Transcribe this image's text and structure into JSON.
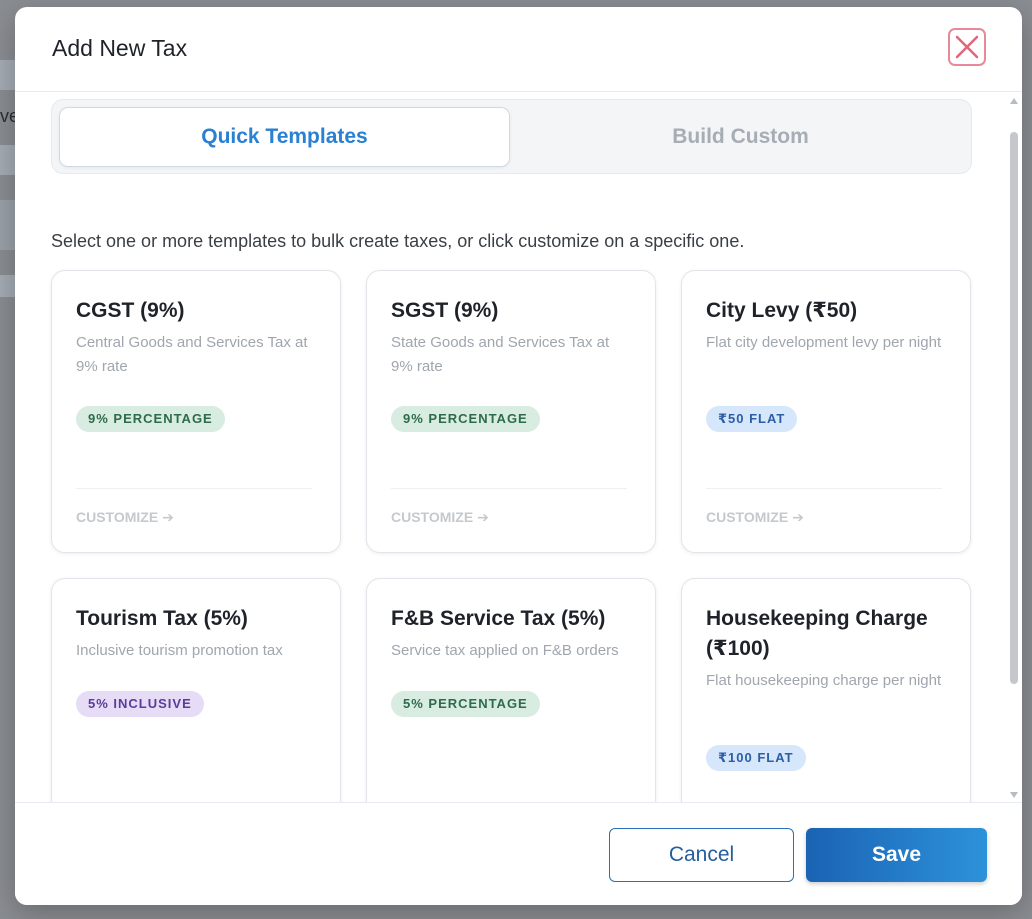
{
  "background": {
    "partial_text": "ve"
  },
  "modal": {
    "title": "Add New Tax",
    "close_icon": "close-x-icon"
  },
  "tabs": [
    {
      "label": "Quick Templates",
      "active": true
    },
    {
      "label": "Build Custom",
      "active": false
    }
  ],
  "intro_text": "Select one or more templates to bulk create taxes, or click customize on a specific one.",
  "templates": [
    {
      "title": "CGST (9%)",
      "description": "Central Goods and Services Tax at 9% rate",
      "badge": "9% PERCENTAGE",
      "badge_color": "#d9ece2",
      "customize_label": "CUSTOMIZE ➔"
    },
    {
      "title": "SGST (9%)",
      "description": "State Goods and Services Tax at 9% rate",
      "badge": "9% PERCENTAGE",
      "badge_color": "#d9ece2",
      "customize_label": "CUSTOMIZE ➔"
    },
    {
      "title": "City Levy (₹50)",
      "description": "Flat city development levy per night",
      "badge": "₹50 FLAT",
      "badge_color": "#d6e6fb",
      "customize_label": "CUSTOMIZE ➔"
    },
    {
      "title": "Tourism Tax (5%)",
      "description": "Inclusive tourism promotion tax",
      "badge": "5% INCLUSIVE",
      "badge_color": "#e6dcf6"
    },
    {
      "title": "F&B Service Tax (5%)",
      "description": "Service tax applied on F&B orders",
      "badge": "5% PERCENTAGE",
      "badge_color": "#d9ece2"
    },
    {
      "title": "Housekeeping Charge (₹100)",
      "description": "Flat housekeeping charge per night",
      "badge": "₹100 FLAT",
      "badge_color": "#d6e6fb"
    }
  ],
  "footer": {
    "cancel_label": "Cancel",
    "save_label": "Save"
  },
  "colors": {
    "accent": "#2a80d2",
    "save_gradient_start": "#1a63b3",
    "save_gradient_end": "#2d92da",
    "close_border": "#e6899a"
  }
}
